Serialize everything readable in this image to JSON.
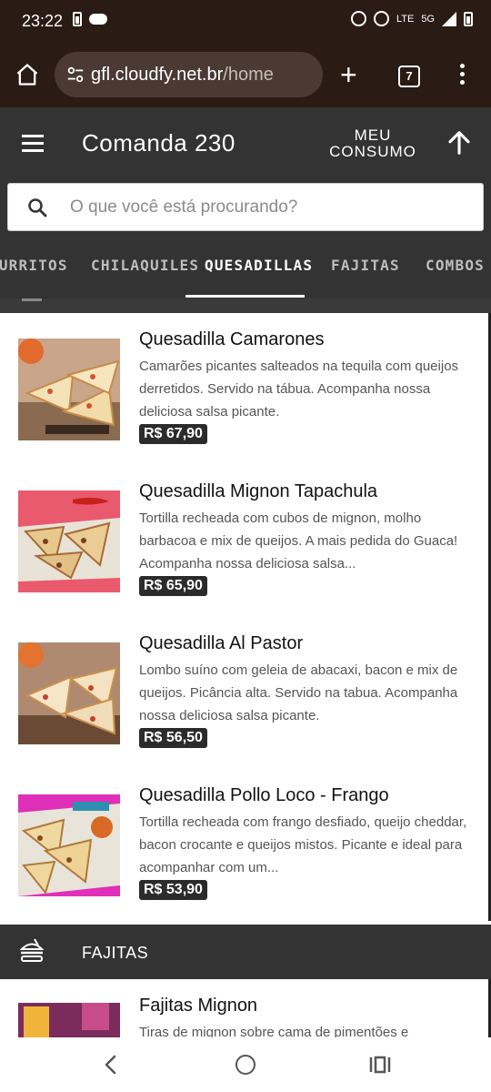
{
  "status_bar": {
    "time": "23:22",
    "network": "5G",
    "volte": "LTE",
    "icons": [
      "battery-saver-icon",
      "cloud-icon",
      "alarm-icon",
      "dnd-icon",
      "volte-icon",
      "signal-icon",
      "battery-icon"
    ]
  },
  "browser": {
    "url_domain": "gfl.cloudfy.net.br",
    "url_path": "/home",
    "tab_count": "7",
    "icons": [
      "home-icon",
      "site-settings-icon",
      "new-tab-icon",
      "tabs-icon",
      "menu-icon"
    ]
  },
  "header": {
    "title": "Comanda 230",
    "meu": "MEU",
    "consumo": "CONSUMO"
  },
  "search": {
    "placeholder": "O que você está procurando?"
  },
  "categories": [
    {
      "label": "BURRITOS"
    },
    {
      "label": "CHILAQUILES"
    },
    {
      "label": "QUESADILLAS",
      "active": true
    },
    {
      "label": "FAJITAS"
    },
    {
      "label": "COMBOS - R"
    }
  ],
  "items": [
    {
      "title": "Quesadilla Camarones",
      "desc": "Camarões picantes salteados na tequila com queijos derretidos. Servido na tábua. Acompanha nossa deliciosa salsa picante.",
      "price": "R$ 67,90"
    },
    {
      "title": "Quesadilla Mignon Tapachula",
      "desc": "Tortilla recheada com cubos de mignon, molho barbacoa e mix de queijos. A mais pedida do Guaca! Acompanha nossa deliciosa salsa...",
      "price": "R$ 65,90"
    },
    {
      "title": "Quesadilla Al Pastor",
      "desc": "Lombo suíno com geleia de abacaxi, bacon e mix de queijos. Picância alta. Servido na tabua. Acompanha nossa deliciosa salsa picante.",
      "price": "R$ 56,50"
    },
    {
      "title": "Quesadilla Pollo Loco - Frango",
      "desc": "Tortilla recheada com frango desfiado, queijo cheddar, bacon crocante e queijos mistos. Picante e ideal para acompanhar com um...",
      "price": "R$ 53,90"
    }
  ],
  "section": {
    "title": "FAJITAS"
  },
  "fajitas_item": {
    "title": "Fajitas Mignon",
    "desc": "Tiras de mignon sobre cama de pimentões e"
  },
  "colors": {
    "status_bg": "#2a1b14",
    "header_bg": "#333333",
    "price_bg": "#2b2b2b"
  }
}
